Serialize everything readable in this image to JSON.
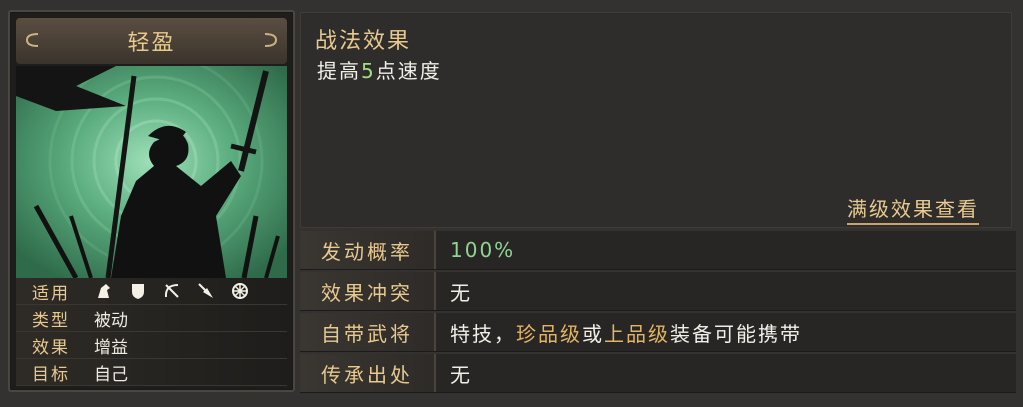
{
  "card": {
    "name": "轻盈",
    "stats": [
      {
        "label": "适用",
        "icons": [
          "cavalry-icon",
          "shield-icon",
          "bow-icon",
          "spear-icon",
          "wheel-icon"
        ]
      },
      {
        "label": "类型",
        "value": "被动"
      },
      {
        "label": "效果",
        "value": "增益"
      },
      {
        "label": "目标",
        "value": "自己"
      }
    ]
  },
  "effect": {
    "title": "战法效果",
    "desc_prefix": "提高",
    "desc_number": "5",
    "desc_suffix": "点速度",
    "max_link": "满级效果查看"
  },
  "info": [
    {
      "label": "发动概率",
      "value": "100%"
    },
    {
      "label": "效果冲突",
      "value": "无"
    },
    {
      "label": "自带武将",
      "value_parts": [
        "特技，",
        "珍品级",
        "或",
        "上品级",
        "装备可能携带"
      ]
    },
    {
      "label": "传承出处",
      "value": "无"
    }
  ],
  "colors": {
    "gold": "#e8c98f",
    "green": "#8fd490",
    "orange": "#e3b463",
    "art_bg": "#58a878"
  }
}
